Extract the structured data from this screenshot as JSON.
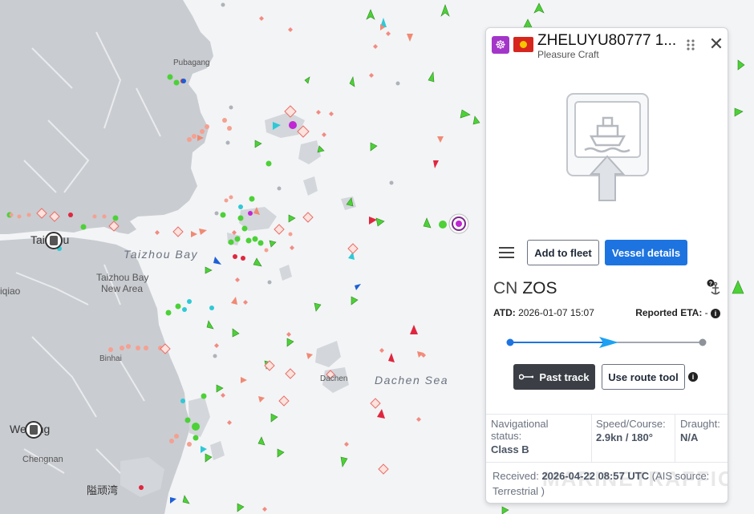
{
  "map": {
    "places": {
      "pubagang": "Pubagang",
      "taizhou_bay": "Taizhou Bay",
      "taizhou_city": "Taizhou",
      "taizhou_bay_new_area_1": "Taizhou Bay",
      "taizhou_bay_new_area_2": "New Area",
      "xiaqiao": "iqiao",
      "binhai": "Binhai",
      "dachen": "Dachen",
      "dachen_sea": "Dachen Sea",
      "wenling": "Wenling",
      "chengnan": "Chengnan",
      "xian": "隘顽湾"
    }
  },
  "panel": {
    "vessel_name": "ZHELUYU80777 1...",
    "vessel_type": "Pleasure Craft",
    "type_icon": "ship-wheel-icon",
    "flag": "china-flag-icon",
    "add_to_fleet": "Add to fleet",
    "vessel_details": "Vessel details",
    "destination_country": "CN",
    "destination_port": "ZOS",
    "atd_label": "ATD:",
    "atd_value": "2026-01-07 15:07",
    "eta_label": "Reported ETA:",
    "eta_value": "-",
    "past_track": "Past track",
    "route_tool": "Use route tool",
    "nav_status_label_1": "Navigational",
    "nav_status_label_2": "status:",
    "nav_status_value": "Class B",
    "speed_label": "Speed/Course:",
    "speed_value": "2.9kn / 180°",
    "draught_label": "Draught:",
    "draught_value": "N/A",
    "received_label": "Received:",
    "received_value": "2026-04-22 08:57 UTC",
    "ais_source": "(AIS source:",
    "ais_source_2": "Terrestrial )",
    "watermark": "MARINETRAFFIC"
  },
  "colors": {
    "primary": "#1d74e0",
    "track": "#1d74e0",
    "sea": "#f3f4f6",
    "land": "#c9ccd1"
  }
}
